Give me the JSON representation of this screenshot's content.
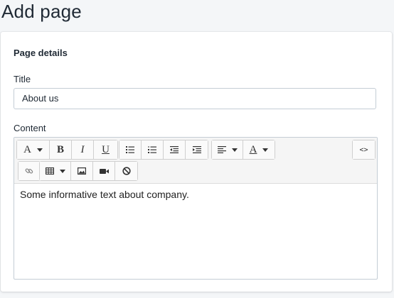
{
  "page": {
    "title": "Add page"
  },
  "card": {
    "section_title": "Page details",
    "title_label": "Title",
    "title_value": "About us",
    "content_label": "Content",
    "content_text": "Some informative text about company."
  },
  "toolbar": {
    "font_style_letter": "A",
    "bold_letter": "B",
    "italic_letter": "I",
    "underline_letter": "U",
    "font_color_letter": "A",
    "code_view_label": "<>",
    "icons": [
      "font-style-icon",
      "bold-icon",
      "italic-icon",
      "underline-icon",
      "unordered-list-icon",
      "ordered-list-icon",
      "outdent-icon",
      "indent-icon",
      "align-left-icon",
      "font-color-icon",
      "code-view-icon",
      "link-icon",
      "table-icon",
      "image-icon",
      "video-icon",
      "clear-format-icon"
    ]
  },
  "colors": {
    "background": "#f4f6f8",
    "card": "#ffffff",
    "border": "#c4cdd5",
    "toolbar": "#f5f5f5"
  }
}
